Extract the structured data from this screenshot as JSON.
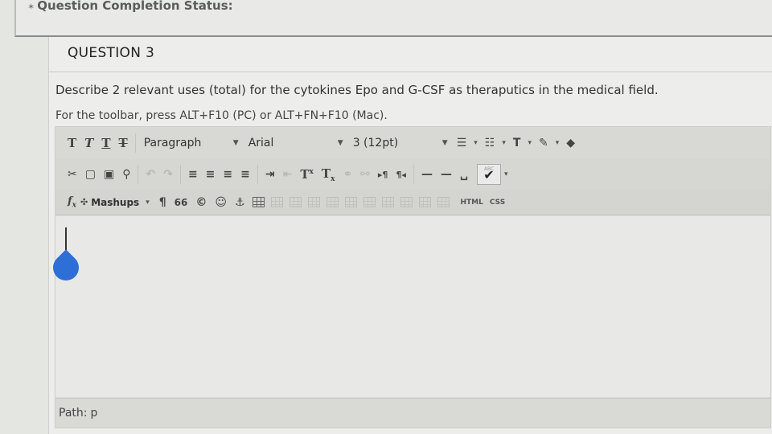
{
  "status": {
    "title": "Question Completion Status:"
  },
  "question": {
    "title": "QUESTION 3",
    "text": "Describe 2 relevant uses (total) for the cytokines Epo and G-CSF as theraputics in the medical field.",
    "hint": "For the toolbar, press ALT+F10 (PC) or ALT+FN+F10 (Mac)."
  },
  "toolbar": {
    "format_buttons": [
      "T",
      "T",
      "T",
      "T"
    ],
    "paragraph": "Paragraph",
    "font": "Arial",
    "size": "3 (12pt)",
    "superscript": "T",
    "subscript": "T",
    "superscript_mark": "x",
    "subscript_mark": "x",
    "pilcrow": "¶",
    "quote": "66",
    "copyright": "©",
    "mashups": "Mashups",
    "html": "HTML",
    "css": "CSS",
    "abc": "ABC"
  },
  "editor": {
    "path_label": "Path:",
    "path_value": "p"
  },
  "colors": {
    "accent_drop": "#2d6fd6",
    "panel": "#ededeb"
  }
}
